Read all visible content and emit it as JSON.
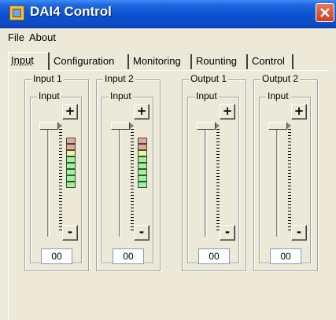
{
  "window": {
    "title": "DAI4 Control",
    "close_icon": "close-icon",
    "app_icon": "app-icon"
  },
  "menu": {
    "items": [
      "File",
      "About"
    ]
  },
  "tabs": [
    {
      "label": "Input",
      "active": true
    },
    {
      "label": "Configuration",
      "active": false
    },
    {
      "label": "Monitoring",
      "active": false
    },
    {
      "label": "Rounting",
      "active": false
    },
    {
      "label": "Control",
      "active": false
    }
  ],
  "channels": [
    {
      "name": "Input 1",
      "sub_label": "Input",
      "plus": "+",
      "minus": "-",
      "value": "00",
      "meter_colors": [
        "#f0a0a0",
        "#f0a0a0",
        "#f0f0a0",
        "#a0f0a0",
        "#a0f0a0",
        "#a0f0a0",
        "#a0f0a0",
        "#a0f0a0"
      ]
    },
    {
      "name": "Input 2",
      "sub_label": "Input",
      "plus": "+",
      "minus": "-",
      "value": "00",
      "meter_colors": [
        "#f0a0a0",
        "#f0a0a0",
        "#f0f0a0",
        "#a0f0a0",
        "#a0f0a0",
        "#a0f0a0",
        "#a0f0a0",
        "#a0f0a0"
      ]
    },
    {
      "name": "Output 1",
      "sub_label": "Input",
      "plus": "+",
      "minus": "-",
      "value": "00"
    },
    {
      "name": "Output 2",
      "sub_label": "Input",
      "plus": "+",
      "minus": "-",
      "value": "00"
    }
  ]
}
